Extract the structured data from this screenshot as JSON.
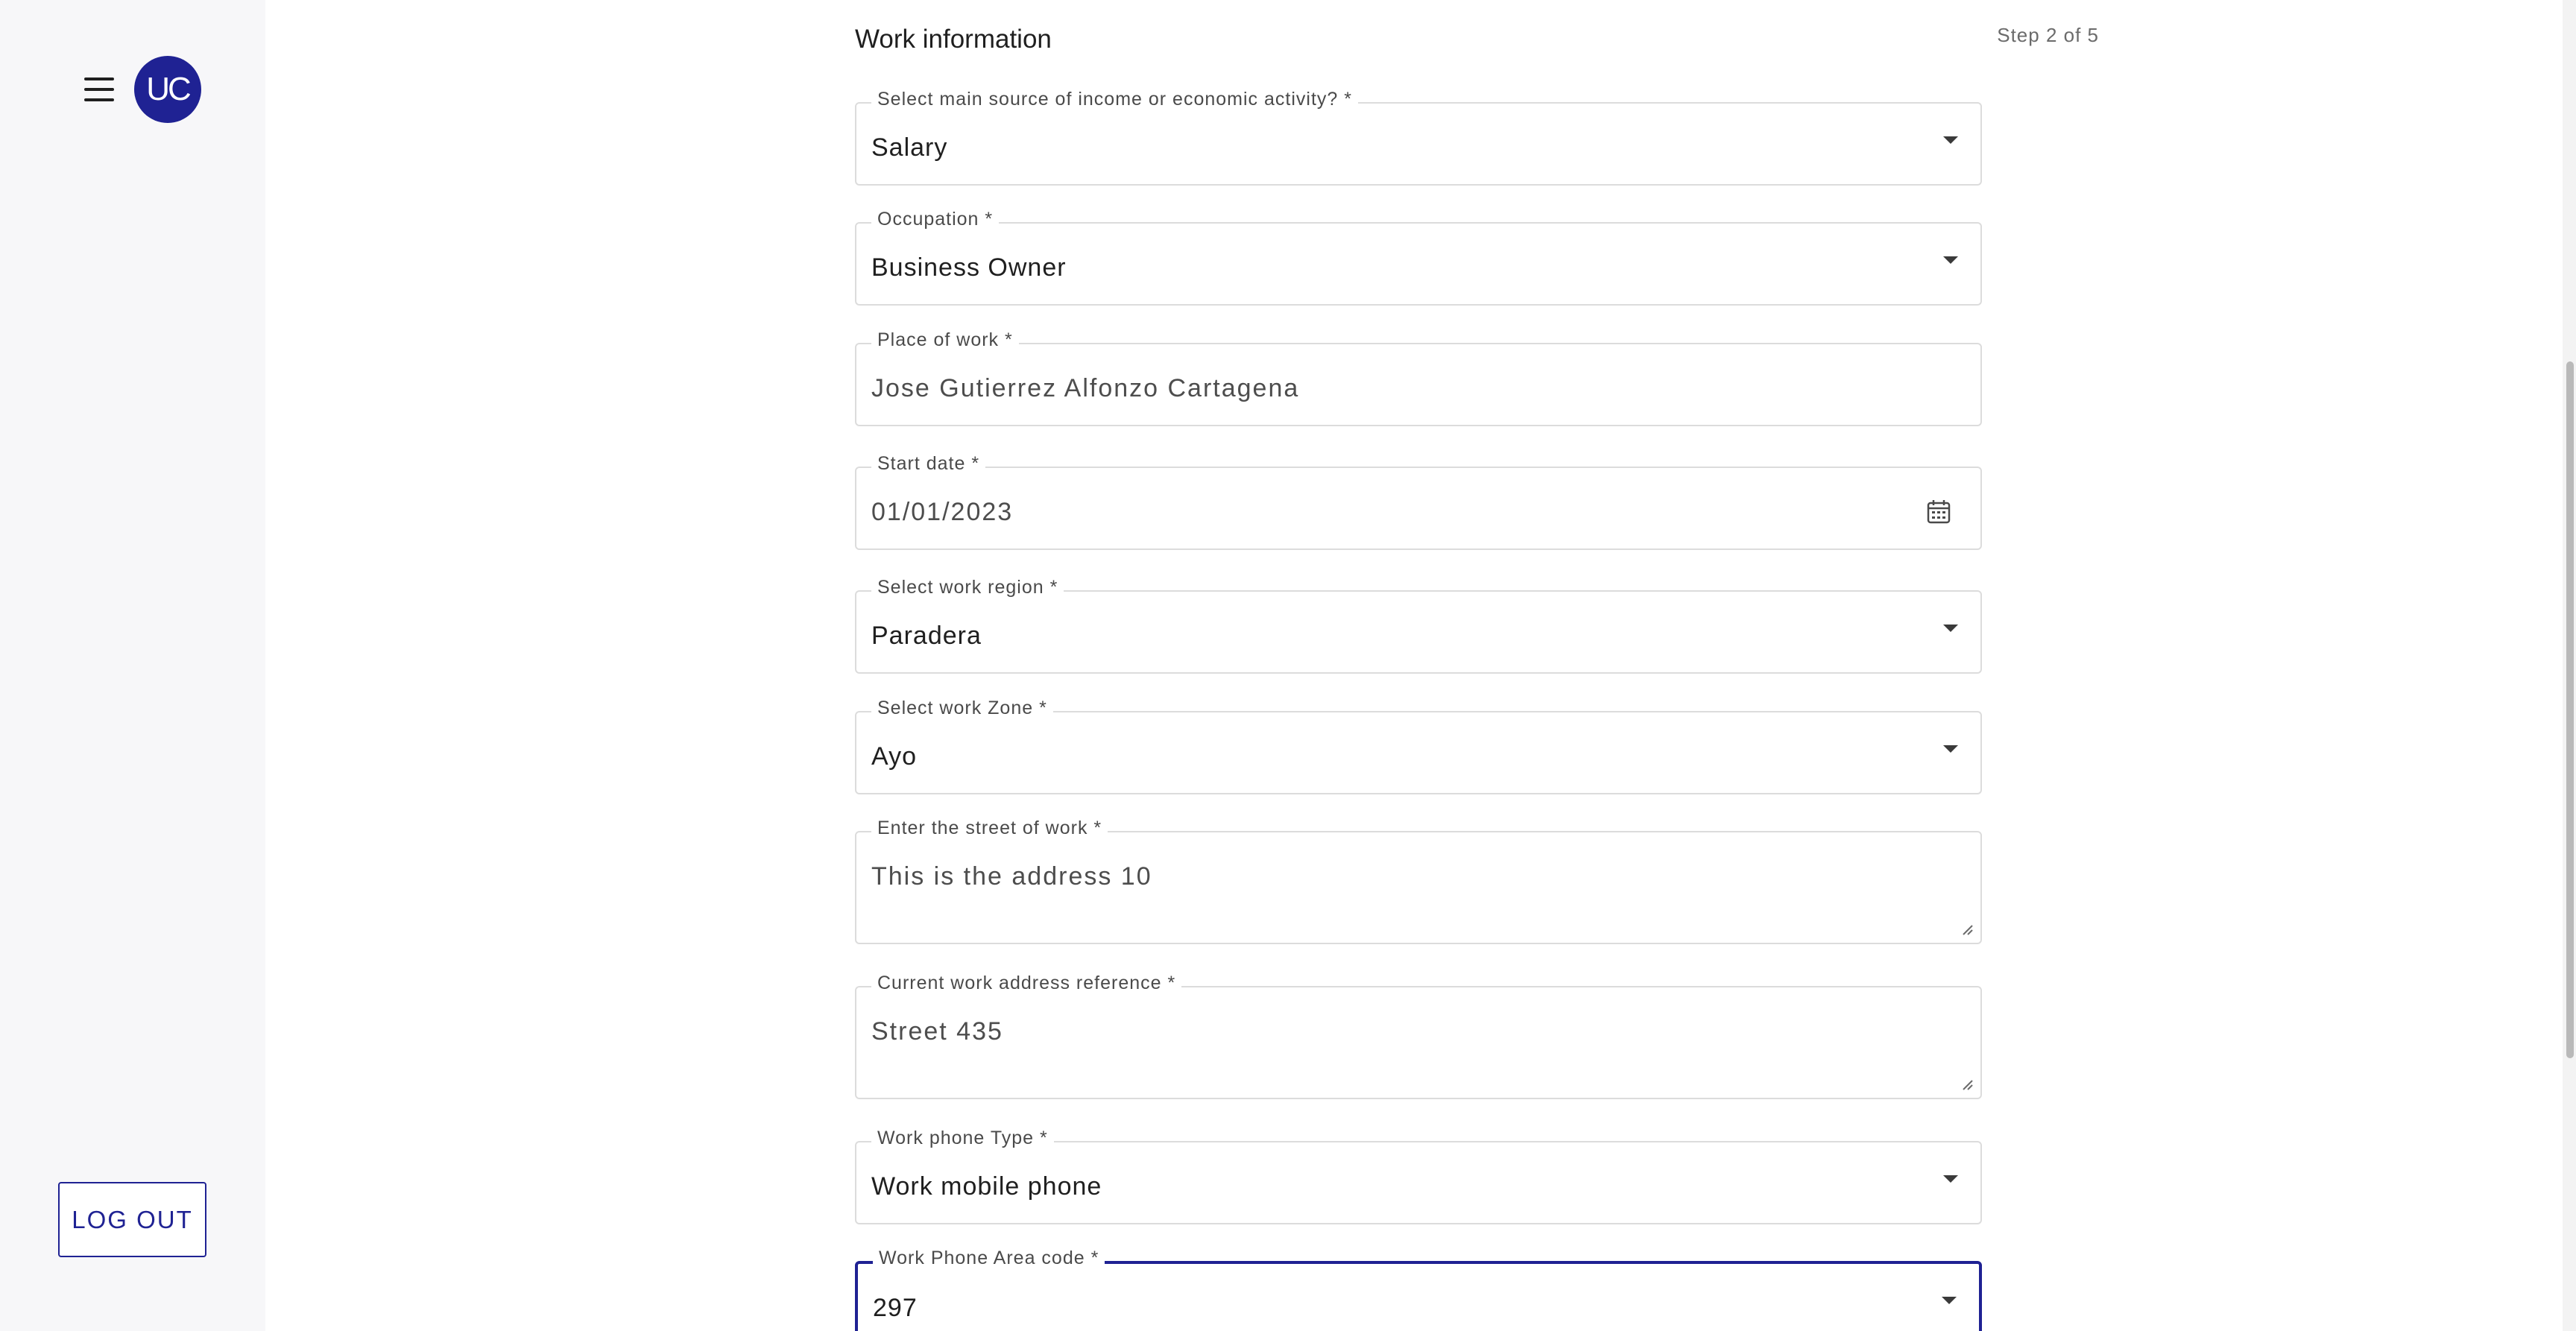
{
  "sidebar": {
    "avatar_initials": "UC",
    "logout_label": "LOG OUT"
  },
  "form": {
    "title": "Work information",
    "step": "Step 2 of 5",
    "fields": {
      "income_source": {
        "label": "Select main source of income or economic activity? *",
        "value": "Salary"
      },
      "occupation": {
        "label": "Occupation *",
        "value": "Business Owner"
      },
      "place_of_work": {
        "label": "Place of work *",
        "value": "Jose Gutierrez Alfonzo Cartagena"
      },
      "start_date": {
        "label": "Start date *",
        "value": "01/01/2023"
      },
      "work_region": {
        "label": "Select work region *",
        "value": "Paradera"
      },
      "work_zone": {
        "label": "Select work Zone *",
        "value": "Ayo"
      },
      "work_street": {
        "label": "Enter the street of work *",
        "value": "This is the address 10"
      },
      "work_address_reference": {
        "label": "Current work address reference *",
        "value": "Street 435"
      },
      "work_phone_type": {
        "label": "Work phone Type *",
        "value": "Work mobile phone"
      },
      "work_phone_area_code": {
        "label": "Work Phone Area code *",
        "value": "297"
      }
    }
  },
  "colors": {
    "accent": "#1f2293",
    "sidebar_bg": "#f7f7f9",
    "field_border": "#dcdcdc"
  },
  "icons": [
    "menu-icon",
    "chevron-down-icon",
    "calendar-icon",
    "resize-handle-icon"
  ]
}
